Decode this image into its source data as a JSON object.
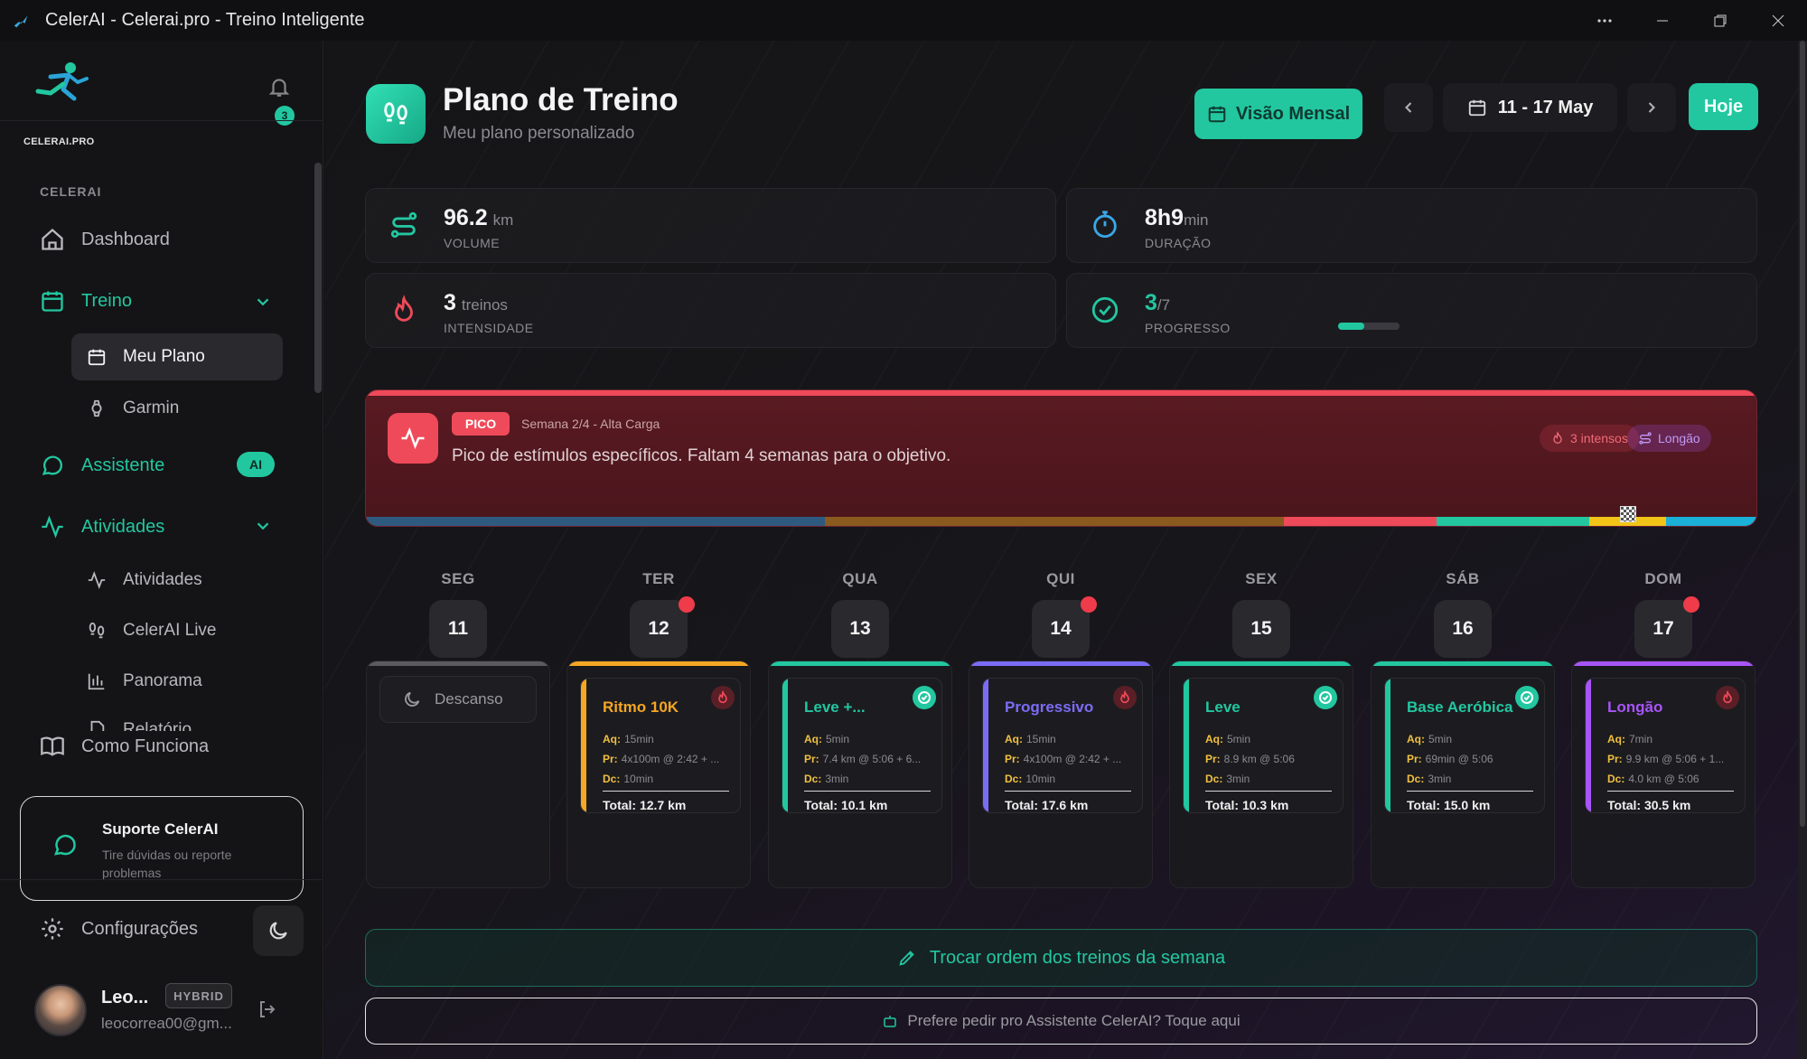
{
  "window": {
    "title": "CelerAI - Celerai.pro - Treino Inteligente"
  },
  "sidebar": {
    "logo_text": "CELERAI.PRO",
    "notifications_count": "3",
    "section_label": "CELERAI",
    "items": {
      "dashboard": "Dashboard",
      "treino": "Treino",
      "meu_plano": "Meu Plano",
      "garmin": "Garmin",
      "assistente": "Assistente",
      "assistente_badge": "AI",
      "atividades_group": "Atividades",
      "atividades": "Atividades",
      "live": "CelerAI Live",
      "panorama": "Panorama",
      "relatorio": "Relatório",
      "como_funciona": "Como Funciona"
    },
    "support": {
      "title": "Suporte CelerAI",
      "subtitle": "Tire dúvidas ou reporte problemas"
    },
    "settings": "Configurações",
    "user": {
      "name": "Leo...",
      "email": "leocorrea00@gm...",
      "plan": "HYBRID"
    }
  },
  "header": {
    "title": "Plano de Treino",
    "subtitle": "Meu plano personalizado",
    "monthly_button": "Visão Mensal",
    "date_range": "11 - 17 May",
    "today_button": "Hoje"
  },
  "stats": {
    "volume": {
      "value": "96.2",
      "unit": "km",
      "label": "VOLUME"
    },
    "duration": {
      "value": "8h9",
      "unit": "min",
      "label": "DURAÇÃO"
    },
    "intensity": {
      "value": "3",
      "unit": "treinos",
      "label": "INTENSIDADE"
    },
    "progress": {
      "value": "3",
      "unit": "/7",
      "label": "PROGRESSO",
      "fraction": 0.43
    }
  },
  "phase": {
    "badge": "PICO",
    "week": "Semana 2/4 - Alta Carga",
    "description": "Pico de estímulos específicos. Faltam 4 semanas para o objetivo.",
    "tag_intense": "3 intensos",
    "tag_long": "Longão",
    "timeline": [
      {
        "color": "#2f5a80",
        "share": 33
      },
      {
        "color": "#8a5a1e",
        "share": 33
      },
      {
        "color": "#ef4a5a",
        "share": 11
      },
      {
        "color": "#22c7a0",
        "share": 11
      },
      {
        "color": "#f2c418",
        "share": 5.5
      },
      {
        "color": "#1ab0d8",
        "share": 6.5
      }
    ]
  },
  "labels": {
    "aq": "Aq:",
    "pr": "Pr:",
    "dc": "Dc:"
  },
  "days": [
    {
      "dn": "SEG",
      "num": "11",
      "accent": "#5a5a60",
      "rest": "Descanso"
    },
    {
      "dn": "TER",
      "num": "12",
      "dot": true,
      "accent": "#f5a623",
      "name": "Ritmo 10K",
      "aq": "15min",
      "pr": "4x100m @ 2:42 + ...",
      "dc": "10min",
      "total": "Total: 12.7 km",
      "status": "fire"
    },
    {
      "dn": "QUA",
      "num": "13",
      "accent": "#22c7a0",
      "name": "Leve +...",
      "aq": "5min",
      "pr": "7.4 km @ 5:06 + 6...",
      "dc": "3min",
      "total": "Total: 10.1 km",
      "status": "done"
    },
    {
      "dn": "QUI",
      "num": "14",
      "dot": true,
      "accent": "#7b6cf6",
      "name": "Progressivo",
      "aq": "15min",
      "pr": "4x100m @ 2:42 + ...",
      "dc": "10min",
      "total": "Total: 17.6 km",
      "status": "fire"
    },
    {
      "dn": "SEX",
      "num": "15",
      "accent": "#22c7a0",
      "name": "Leve",
      "aq": "5min",
      "pr": "8.9 km @ 5:06",
      "dc": "3min",
      "total": "Total: 10.3 km",
      "status": "done"
    },
    {
      "dn": "SÁB",
      "num": "16",
      "accent": "#22c7a0",
      "name": "Base Aeróbica",
      "aq": "5min",
      "pr": "69min @ 5:06",
      "dc": "3min",
      "total": "Total: 15.0 km",
      "status": "done"
    },
    {
      "dn": "DOM",
      "num": "17",
      "dot": true,
      "accent": "#a855f7",
      "name": "Longão",
      "aq": "7min",
      "pr": "9.9 km @ 5:06 + 1...",
      "dc": "4.0 km @ 5:06",
      "total": "Total: 30.5 km",
      "status": "fire"
    }
  ],
  "actions": {
    "swap": "Trocar ordem dos treinos da semana",
    "ask": "Prefere pedir pro Assistente CelerAI? Toque aqui"
  }
}
